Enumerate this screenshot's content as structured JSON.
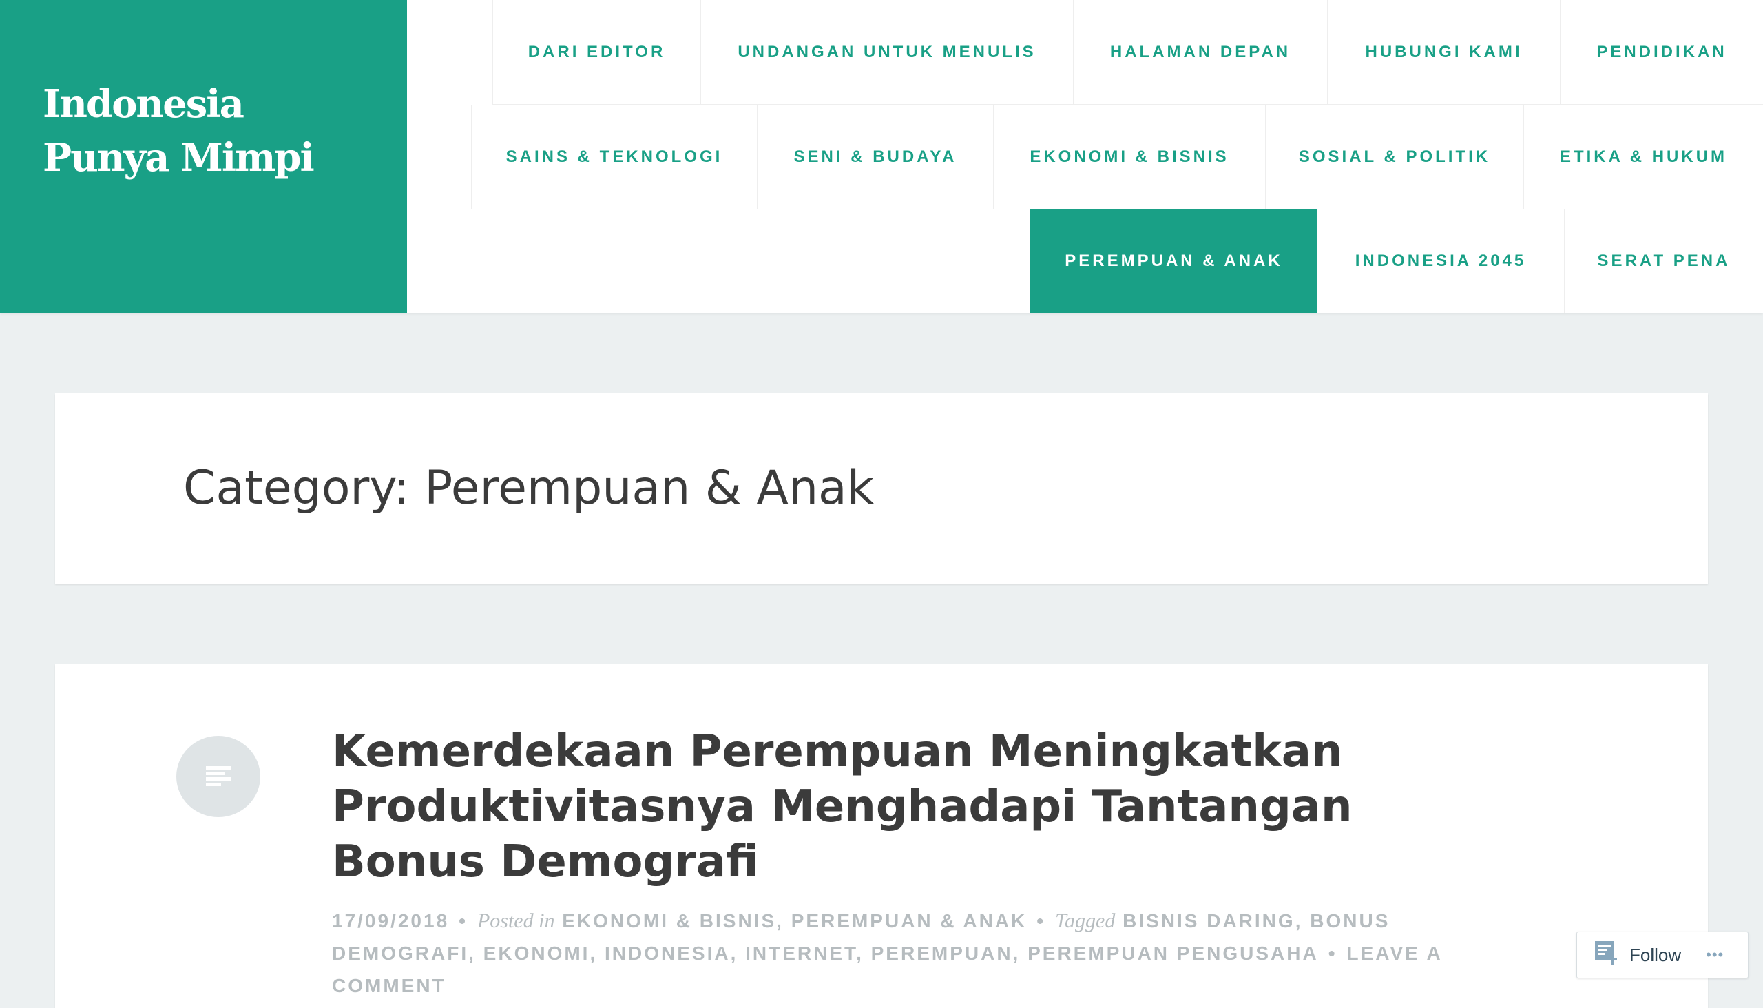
{
  "site": {
    "title": "Indonesia Punya Mimpi"
  },
  "nav": {
    "row1": [
      "DARI EDITOR",
      "UNDANGAN UNTUK MENULIS",
      "HALAMAN DEPAN",
      "HUBUNGI KAMI",
      "PENDIDIKAN"
    ],
    "row2": [
      "SAINS & TEKNOLOGI",
      "SENI & BUDAYA",
      "EKONOMI & BISNIS",
      "SOSIAL & POLITIK",
      "ETIKA & HUKUM"
    ],
    "row3": [
      "PEREMPUAN & ANAK",
      "INDONESIA 2045",
      "SERAT PENA"
    ],
    "active": "PEREMPUAN & ANAK"
  },
  "archive": {
    "title": "Category: Perempuan & Anak"
  },
  "post": {
    "title": "Kemerdekaan Perempuan Meningkatkan Produktivitasnya Menghadapi Tantangan Bonus Demografi",
    "date": "17/09/2018",
    "posted_in_label": "Posted in",
    "categories": [
      "EKONOMI & BISNIS",
      "PEREMPUAN & ANAK"
    ],
    "tagged_label": "Tagged",
    "tags": [
      "BISNIS DARING",
      "BONUS DEMOGRAFI",
      "EKONOMI",
      "INDONESIA",
      "INTERNET",
      "PEREMPUAN",
      "PEREMPUAN PENGUSAHA"
    ],
    "comment_link": "LEAVE A COMMENT"
  },
  "follow": {
    "label": "Follow",
    "more": "•••"
  },
  "colors": {
    "accent": "#19a086",
    "background": "#ecf0f1"
  }
}
